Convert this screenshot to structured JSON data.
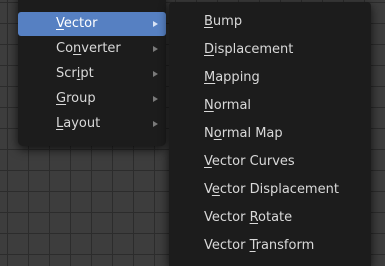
{
  "submenu_parent": {
    "items": [
      {
        "label": "Vector",
        "mnemonic": 0,
        "active": true,
        "has_submenu": true
      },
      {
        "label": "Converter",
        "mnemonic": 2,
        "active": false,
        "has_submenu": true
      },
      {
        "label": "Script",
        "mnemonic": 3,
        "active": false,
        "has_submenu": true
      },
      {
        "label": "Group",
        "mnemonic": 0,
        "active": false,
        "has_submenu": true
      },
      {
        "label": "Layout",
        "mnemonic": 0,
        "active": false,
        "has_submenu": true
      }
    ]
  },
  "vector_submenu": {
    "items": [
      {
        "label": "Bump",
        "mnemonic": 0
      },
      {
        "label": "Displacement",
        "mnemonic": 0
      },
      {
        "label": "Mapping",
        "mnemonic": 0
      },
      {
        "label": "Normal",
        "mnemonic": 0
      },
      {
        "label": "Normal Map",
        "mnemonic": 1
      },
      {
        "label": "Vector Curves",
        "mnemonic": 0
      },
      {
        "label": "Vector Displacement",
        "mnemonic": 1
      },
      {
        "label": "Vector Rotate",
        "mnemonic": 7
      },
      {
        "label": "Vector Transform",
        "mnemonic": 7
      }
    ]
  },
  "colors": {
    "menu_background": "#1c1c1c",
    "highlight": "#5680c2",
    "text": "#d9d9d9",
    "canvas": "#3d3d3d",
    "grid_lines": "#2c2c2c"
  },
  "icons": {
    "submenu_arrow": "chevron-right-icon"
  }
}
